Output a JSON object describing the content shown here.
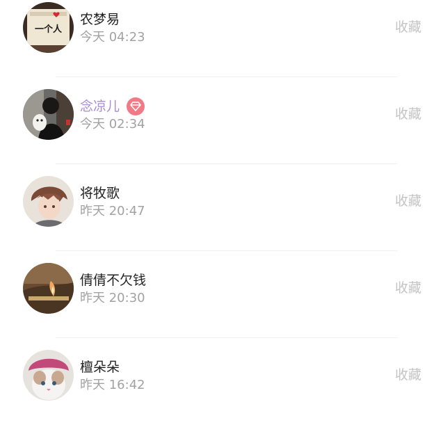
{
  "collect_label": "收藏",
  "vip_badge_color": "#f07a86",
  "vip_name_color": "#a98bd6",
  "rows": [
    {
      "name": "农梦易",
      "time": "今天 04:23",
      "vip": false,
      "avatar_text": "一个人"
    },
    {
      "name": "念凉儿",
      "time": "今天 02:34",
      "vip": true
    },
    {
      "name": "将牧歌",
      "time": "昨天 20:47",
      "vip": false
    },
    {
      "name": "倩倩不欠钱",
      "time": "昨天 20:30",
      "vip": false
    },
    {
      "name": "檀朵朵",
      "time": "昨天 16:42",
      "vip": false
    }
  ]
}
